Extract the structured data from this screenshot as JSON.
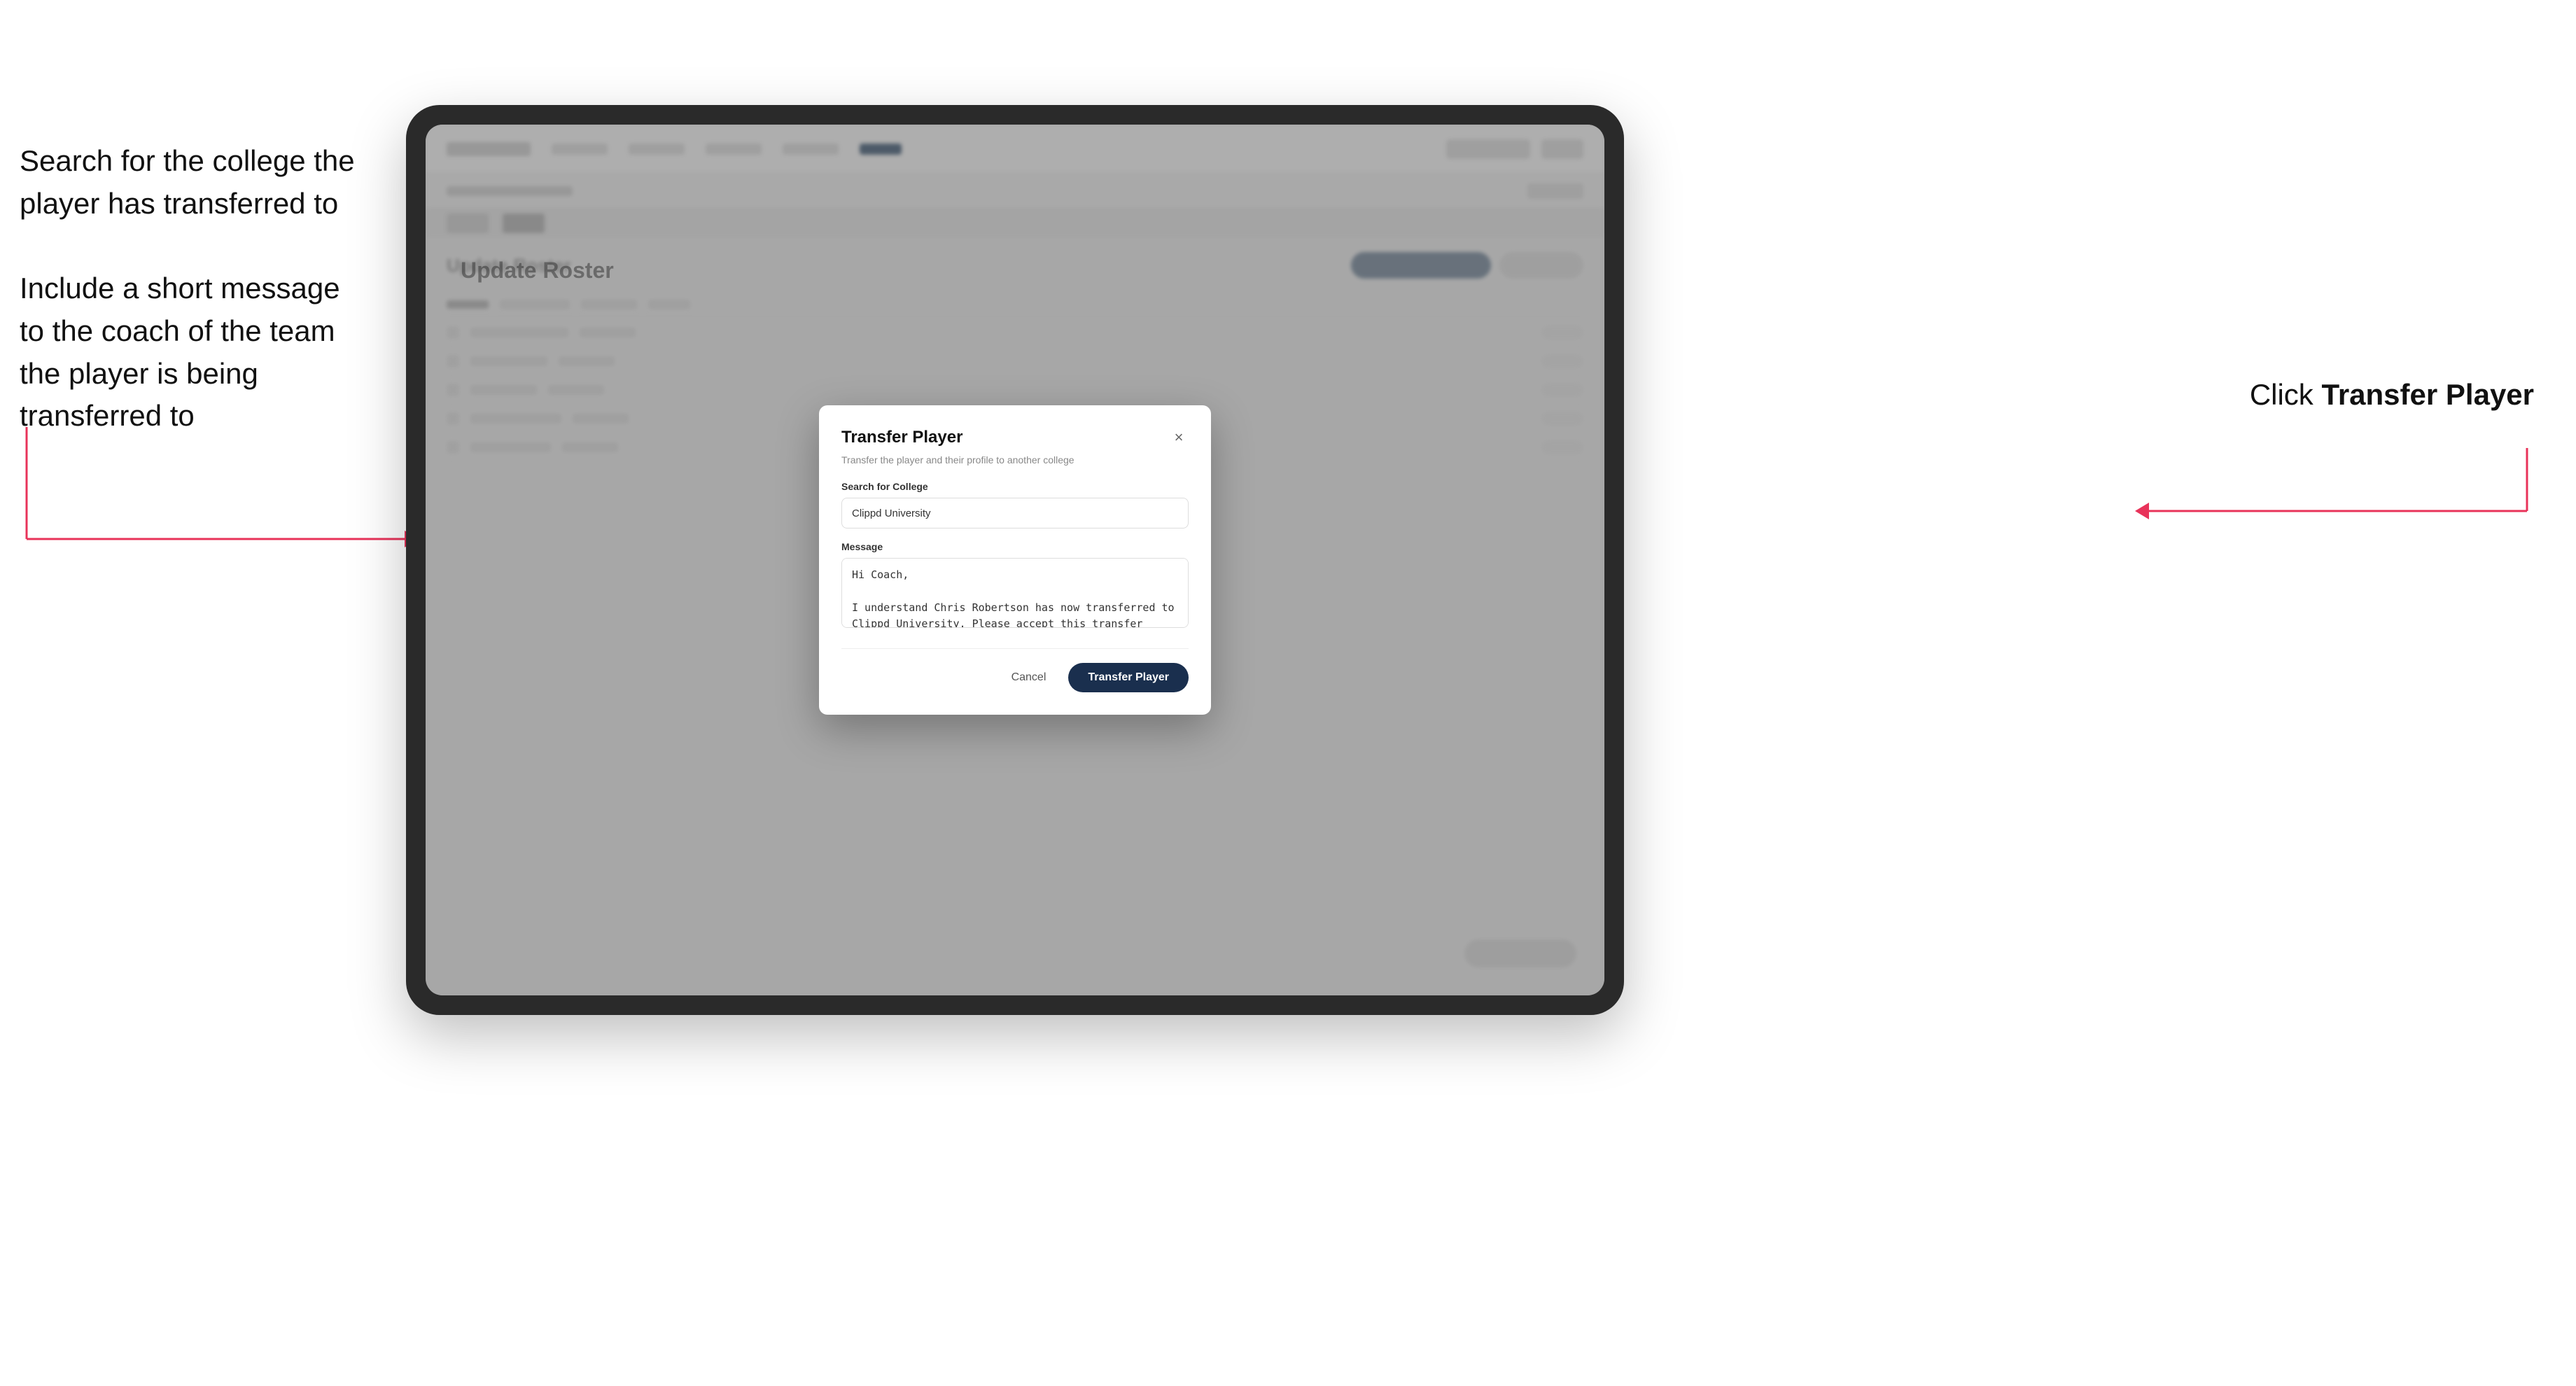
{
  "annotations": {
    "left_block1_line1": "Search for the college the",
    "left_block1_line2": "player has transferred to",
    "left_block2_line1": "Include a short message",
    "left_block2_line2": "to the coach of the team",
    "left_block2_line3": "the player is being",
    "left_block2_line4": "transferred to",
    "right_prefix": "Click ",
    "right_bold": "Transfer Player"
  },
  "modal": {
    "title": "Transfer Player",
    "subtitle": "Transfer the player and their profile to another college",
    "search_label": "Search for College",
    "search_value": "Clippd University",
    "message_label": "Message",
    "message_value": "Hi Coach,\n\nI understand Chris Robertson has now transferred to Clippd University. Please accept this transfer request when you can.",
    "cancel_label": "Cancel",
    "transfer_label": "Transfer Player"
  },
  "bg": {
    "page_title": "Update Roster"
  }
}
